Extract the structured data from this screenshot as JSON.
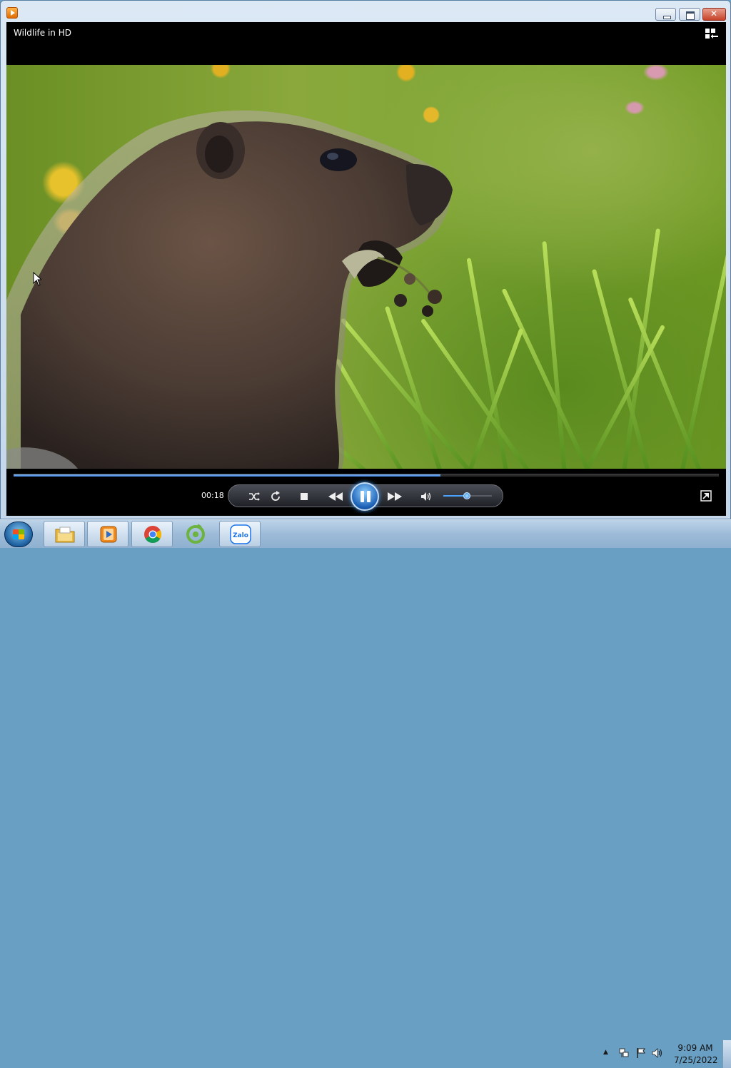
{
  "window": {
    "app": "Windows Media Player",
    "now_playing_title": "Wildlife in HD"
  },
  "playback": {
    "elapsed": "00:18",
    "progress_fraction": 0.605,
    "volume_fraction": 0.5,
    "state": "playing"
  },
  "icons": {
    "app": "media-player-icon",
    "switch_library": "switch-to-library-icon",
    "shuffle": "shuffle-icon",
    "repeat": "repeat-icon",
    "stop": "stop-icon",
    "previous": "previous-icon",
    "pause": "pause-icon",
    "next": "next-icon",
    "mute": "speaker-icon",
    "fullscreen": "fullscreen-icon"
  },
  "taskbar": {
    "items": [
      {
        "name": "explorer",
        "icon": "folder-icon"
      },
      {
        "name": "windows-media-player",
        "icon": "media-player-icon"
      },
      {
        "name": "chrome",
        "icon": "chrome-icon"
      },
      {
        "name": "coccoc",
        "icon": "coccoc-icon"
      },
      {
        "name": "zalo",
        "icon": "zalo-icon",
        "label": "Zalo"
      }
    ]
  },
  "tray": {
    "time": "9:09 AM",
    "date": "7/25/2022"
  },
  "colors": {
    "accent": "#3477d4",
    "player_bg": "#000000",
    "taskbar": "#9dbbd8"
  }
}
